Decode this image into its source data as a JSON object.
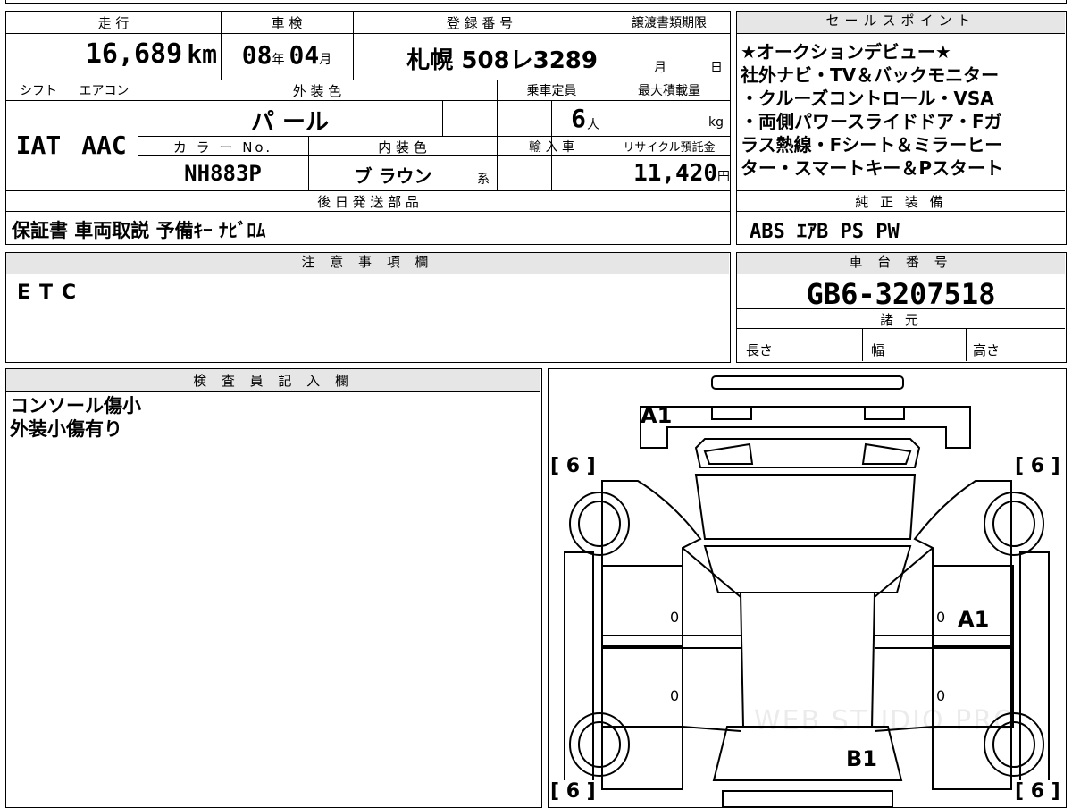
{
  "vehicle": {
    "mileage_header": "走 行",
    "mileage_value": "16,689",
    "mileage_unit": "km",
    "inspection_header": "車 検",
    "inspection_year": "08",
    "inspection_year_unit": "年",
    "inspection_month": "04",
    "inspection_month_unit": "月",
    "registration_header": "登 録 番 号",
    "registration_value": "札幌 508レ3289",
    "transfer_header": "譲渡書類期限",
    "transfer_month_unit": "月",
    "transfer_day_unit": "日",
    "shift_header": "シフト",
    "shift_value": "IAT",
    "aircon_header": "エアコン",
    "aircon_value": "AAC",
    "exterior_color_header": "外 装 色",
    "exterior_color_value": "パ ール",
    "capacity_header": "乗車定員",
    "capacity_value": "6",
    "capacity_unit": "人",
    "max_load_header": "最大積載量",
    "max_load_unit": "kg",
    "color_no_header": "カ ラ ー No.",
    "color_no_value": "NH883P",
    "interior_color_header": "内 装 色",
    "interior_color_value": "ブ ラウン",
    "interior_color_suffix": "系",
    "import_header": "輸 入 車",
    "recycle_header": "リサイクル預託金",
    "recycle_value": "11,420",
    "recycle_unit": "円"
  },
  "sales_points": {
    "header": "セールスポイント",
    "lines": [
      "★オークションデビュー★",
      "社外ナビ・TV＆バックモニター",
      "・クルーズコントロール・VSA",
      "・両側パワースライドドア・Fガ",
      "ラス熱線・Fシート＆ミラーヒー",
      "ター・スマートキー＆Pスタート"
    ]
  },
  "later_parts": {
    "header": "後 日 発 送 部 品",
    "value": "保証書 車両取説 予備ｷｰ ﾅﾋﾞﾛﾑ"
  },
  "genuine_equipment": {
    "header": "純 正 装 備",
    "value": "ABS ｴｱB PS PW"
  },
  "notes": {
    "header": "注 意 事 項 欄",
    "value": "ETC"
  },
  "chassis": {
    "header": "車 台 番 号",
    "value": "GB6-3207518",
    "specs_header": "諸 元",
    "length_label": "長さ",
    "width_label": "幅",
    "height_label": "高さ"
  },
  "inspector": {
    "header": "検 査 員 記 入 欄",
    "lines": [
      "コンソール傷小",
      "外装小傷有り"
    ]
  },
  "diagram": {
    "tire_fl": "[ 6 ]",
    "tire_fr": "[ 6 ]",
    "tire_rl": "[ 6 ]",
    "tire_rr": "[ 6 ]",
    "mark_front": "A1",
    "mark_right_door": "A1",
    "mark_rear": "B1",
    "door_left_front": "0",
    "door_left_rear": "0",
    "door_right_front": "0",
    "door_right_rear": "0",
    "watermark": "WEB STUDIO PRO"
  }
}
